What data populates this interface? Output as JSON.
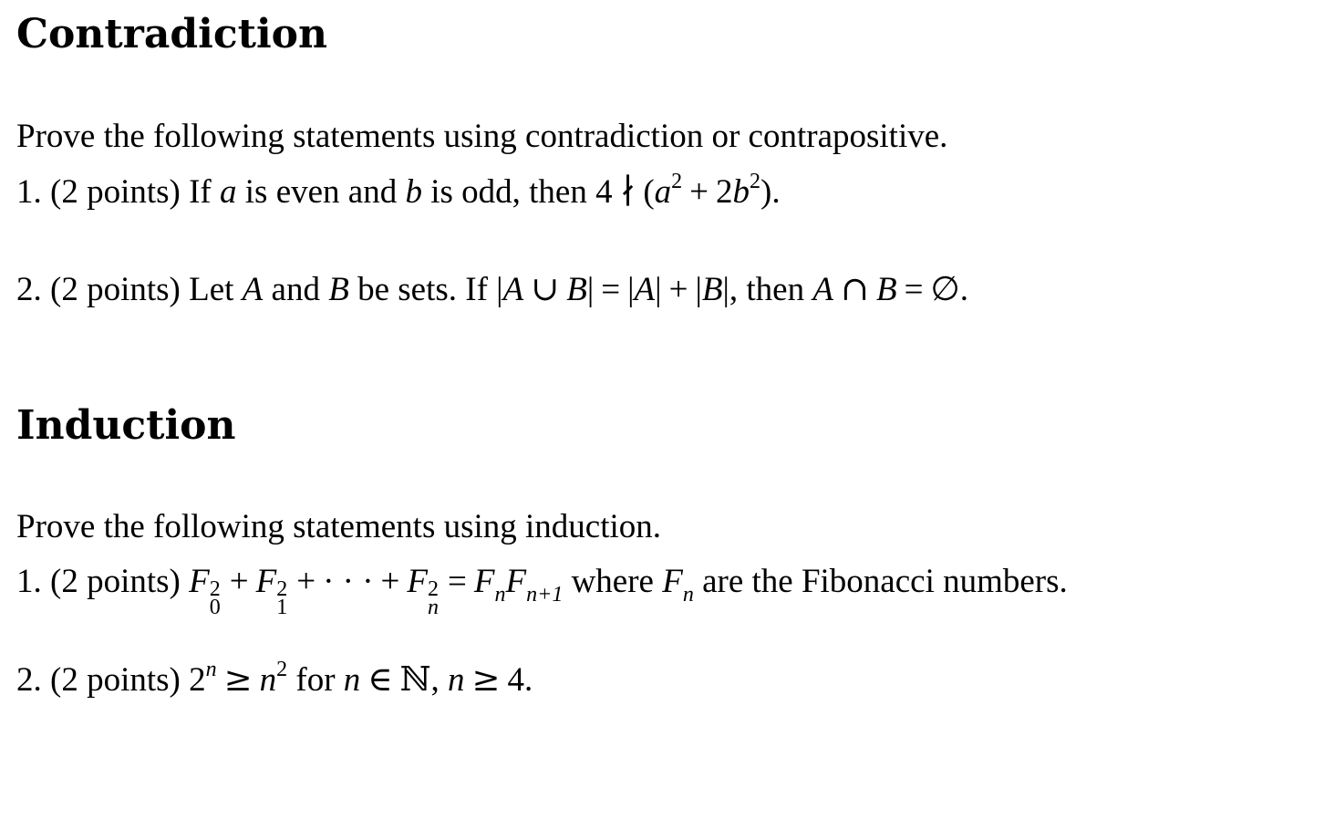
{
  "sections": [
    {
      "title": "Contradiction",
      "intro": "Prove the following statements using contradiction or contrapositive.",
      "problems": [
        {
          "number": "1.",
          "points": "(2 points)",
          "text_plain": "If a is even and b is odd, then 4 ∤ (a² + 2b²).",
          "seg": {
            "t1": "If ",
            "v_a": "a",
            "t2": " is even and ",
            "v_b": "b",
            "t3": " is odd, then ",
            "four": "4",
            "ndiv": "∤",
            "lp": "(",
            "a": "a",
            "exp2a": "2",
            "plus": "+",
            "two": "2",
            "b": "b",
            "exp2b": "2",
            "rp": ").",
            "end": ""
          }
        },
        {
          "number": "2.",
          "points": "(2 points)",
          "text_plain": "Let A and B be sets. If |A ∪ B| = |A| + |B|, then A ∩ B = ∅.",
          "seg": {
            "t1": "Let ",
            "A1": "A",
            "t2": " and ",
            "B1": "B",
            "t3": " be sets.  If ",
            "bar": "|",
            "A2": "A",
            "cup": "∪",
            "B2": "B",
            "eq": "=",
            "A3": "A",
            "plus": "+",
            "B3": "B",
            "t4": ", then ",
            "A4": "A",
            "cap": "∩",
            "B4": "B",
            "eq2": "=",
            "empty": "∅",
            "end": "."
          }
        }
      ]
    },
    {
      "title": "Induction",
      "intro": "Prove the following statements using induction.",
      "problems": [
        {
          "number": "1.",
          "points": "(2 points)",
          "text_plain": "F₀² + F₁² + ⋯ + Fₙ² = FₙFₙ₊₁ where Fₙ are the Fibonacci numbers.",
          "seg": {
            "F": "F",
            "sq": "2",
            "s0": "0",
            "s1": "1",
            "sn": "n",
            "plus": "+",
            "dots": "· · ·",
            "eq": "=",
            "sn1": "n+1",
            "t1": " where ",
            "t2": " are the Fibonacci numbers."
          }
        },
        {
          "number": "2.",
          "points": "(2 points)",
          "text_plain": "2ⁿ ≥ n² for n ∈ ℕ, n ≥ 4.",
          "seg": {
            "two": "2",
            "n": "n",
            "geq": "≥",
            "sq": "2",
            "for": " for ",
            "in": "∈",
            "nat": "ℕ",
            "comma": ",",
            "four": "4.",
            "end": ""
          }
        }
      ]
    }
  ]
}
